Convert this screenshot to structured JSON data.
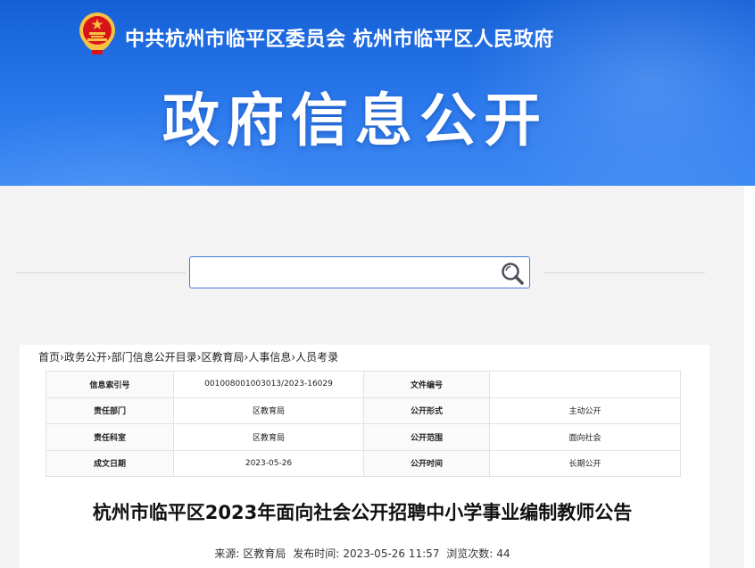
{
  "header": {
    "org_title": "中共杭州市临平区委员会  杭州市临平区人民政府",
    "big_title": "政府信息公开"
  },
  "search": {
    "value": "",
    "placeholder": ""
  },
  "breadcrumb": {
    "items": [
      "首页",
      "政务公开",
      "部门信息公开目录",
      "区教育局",
      "人事信息",
      "人员考录"
    ],
    "separator": "›"
  },
  "meta": {
    "rows": [
      [
        {
          "label": "信息索引号",
          "value": "001008001003013/2023-16029"
        },
        {
          "label": "文件编号",
          "value": ""
        }
      ],
      [
        {
          "label": "责任部门",
          "value": "区教育局"
        },
        {
          "label": "公开形式",
          "value": "主动公开"
        }
      ],
      [
        {
          "label": "责任科室",
          "value": "区教育局"
        },
        {
          "label": "公开范围",
          "value": "面向社会"
        }
      ],
      [
        {
          "label": "成文日期",
          "value": "2023-05-26"
        },
        {
          "label": "公开时间",
          "value": "长期公开"
        }
      ]
    ]
  },
  "article": {
    "title": "杭州市临平区2023年面向社会公开招聘中小学事业编制教师公告",
    "source_label": "来源:",
    "source": "区教育局",
    "publish_label": "发布时间:",
    "publish_time": "2023-05-26 11:57",
    "views_label": "浏览次数:",
    "views": "44"
  },
  "colors": {
    "banner_top": "#1560d6",
    "banner_bottom": "#3d88f2",
    "search_border": "#3d7ad6",
    "emblem_red": "#d8141b",
    "emblem_gold": "#f6c343"
  }
}
